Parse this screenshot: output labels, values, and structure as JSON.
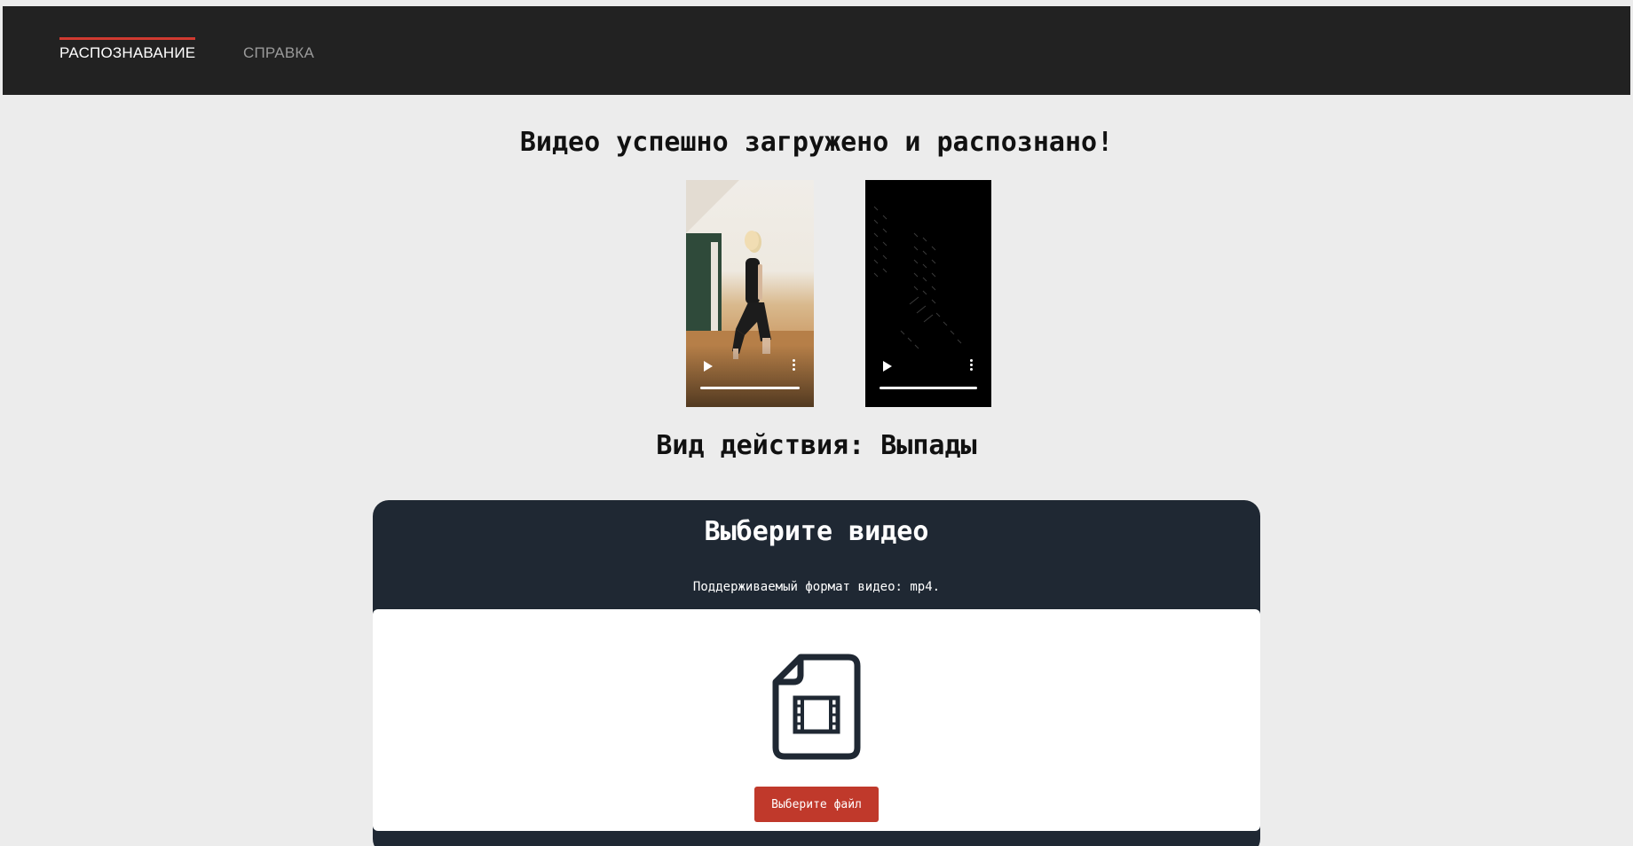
{
  "nav": {
    "items": [
      {
        "label": "РАСПОЗНАВАНИЕ",
        "active": true
      },
      {
        "label": "СПРАВКА",
        "active": false
      }
    ]
  },
  "main": {
    "success_message": "Видео успешно загружено и распознано!",
    "result_label": "Вид действия: Выпады"
  },
  "upload": {
    "title": "Выберите видео",
    "hint": "Поддерживаемый формат видео: mp4.",
    "button_label": "Выберите файл",
    "icon": "video-file-icon"
  },
  "colors": {
    "navbar": "#222222",
    "accent": "#d13a30",
    "card": "#1f2833",
    "button": "#c0392b",
    "background": "#ececec"
  }
}
